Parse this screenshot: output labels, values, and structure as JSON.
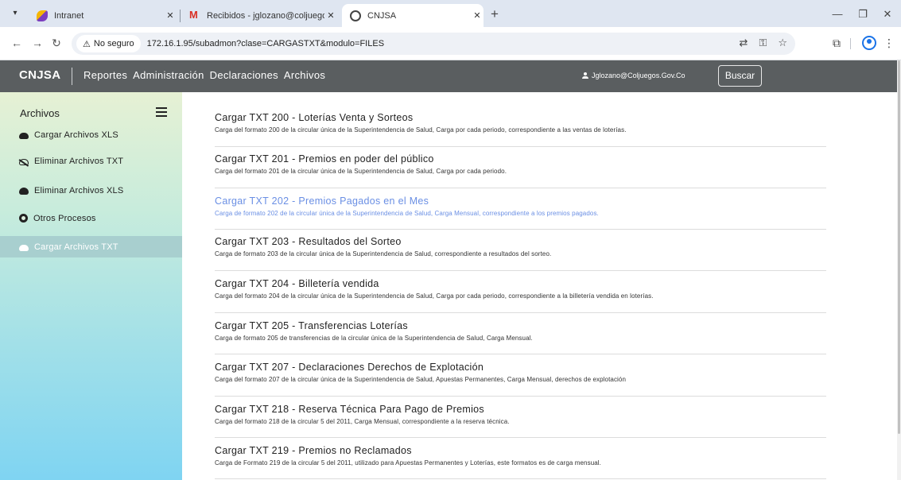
{
  "browser": {
    "tabs": [
      {
        "title": "Intranet"
      },
      {
        "title": "Recibidos - jglozano@coljuegos"
      },
      {
        "title": "CNJSA"
      }
    ],
    "address": {
      "security_label": "No seguro",
      "url": "172.16.1.95/subadmon?clase=CARGASTXT&modulo=FILES"
    }
  },
  "app": {
    "brand": "CNJSA",
    "nav": [
      "Reportes",
      "Administración",
      "Declaraciones",
      "Archivos"
    ],
    "user": "Jglozano@Coljuegos.Gov.Co",
    "search_button": "Buscar"
  },
  "sidebar": {
    "title": "Archivos",
    "items": [
      {
        "label": "Cargar Archivos XLS",
        "icon": "cloud-upload-icon"
      },
      {
        "label": "Eliminar Archivos TXT",
        "icon": "cloud-off-icon"
      },
      {
        "label": "Eliminar Archivos XLS",
        "icon": "cloud-download-icon"
      },
      {
        "label": "Otros Procesos",
        "icon": "gear-icon"
      },
      {
        "label": "Cargar Archivos TXT",
        "icon": "cloud-icon",
        "active": true
      }
    ]
  },
  "uploads": [
    {
      "title": "Cargar TXT 200 - Loterías Venta y Sorteos",
      "desc": "Carga del formato 200 de la circular única de la Superintendencia de Salud, Carga por cada periodo, correspondiente a las ventas de loterías."
    },
    {
      "title": "Cargar TXT 201 - Premios en poder del público",
      "desc": "Carga del formato 201 de la circular única de la Superintendencia de Salud, Carga por cada periodo."
    },
    {
      "title": "Cargar TXT 202 - Premios Pagados en el Mes",
      "desc": "Carga de formato 202 de la circular única de la Superintendencia de Salud, Carga Mensual, correspondiente a los premios pagados.",
      "active": true
    },
    {
      "title": "Cargar TXT 203 - Resultados del Sorteo",
      "desc": "Carga de formato 203 de la circular única de la Superintendencia de Salud, correspondiente a resultados del sorteo."
    },
    {
      "title": "Cargar TXT 204 - Billetería vendida",
      "desc": "Carga del formato 204 de la circular única de la Superintendencia de Salud, Carga por cada periodo, correspondiente a la billetería vendida en loterías."
    },
    {
      "title": "Cargar TXT 205 - Transferencias Loterías",
      "desc": "Carga de formato 205 de transferencias de la circular única de la Superintendencia de Salud, Carga Mensual."
    },
    {
      "title": "Cargar TXT 207 - Declaraciones Derechos de Explotación",
      "desc": "Carga del formato 207 de la circular única de la Superintendencia de Salud, Apuestas Permanentes, Carga Mensual, derechos de explotación"
    },
    {
      "title": "Cargar TXT 218 - Reserva Técnica Para Pago de Premios",
      "desc": "Carga del formato 218 de la circular 5 del 2011, Carga Mensual, correspondiente a la reserva técnica."
    },
    {
      "title": "Cargar TXT 219 - Premios no Reclamados",
      "desc": "Carga de Formato 219 de la circular 5 del 2011, utilizado para Apuestas Permanentes y Loterías, este formatos es de carga mensual."
    }
  ],
  "colors": {
    "navbar": "#5a5e60",
    "active_link": "#6a8fe4",
    "sidebar_active": "#a8cfcf"
  }
}
